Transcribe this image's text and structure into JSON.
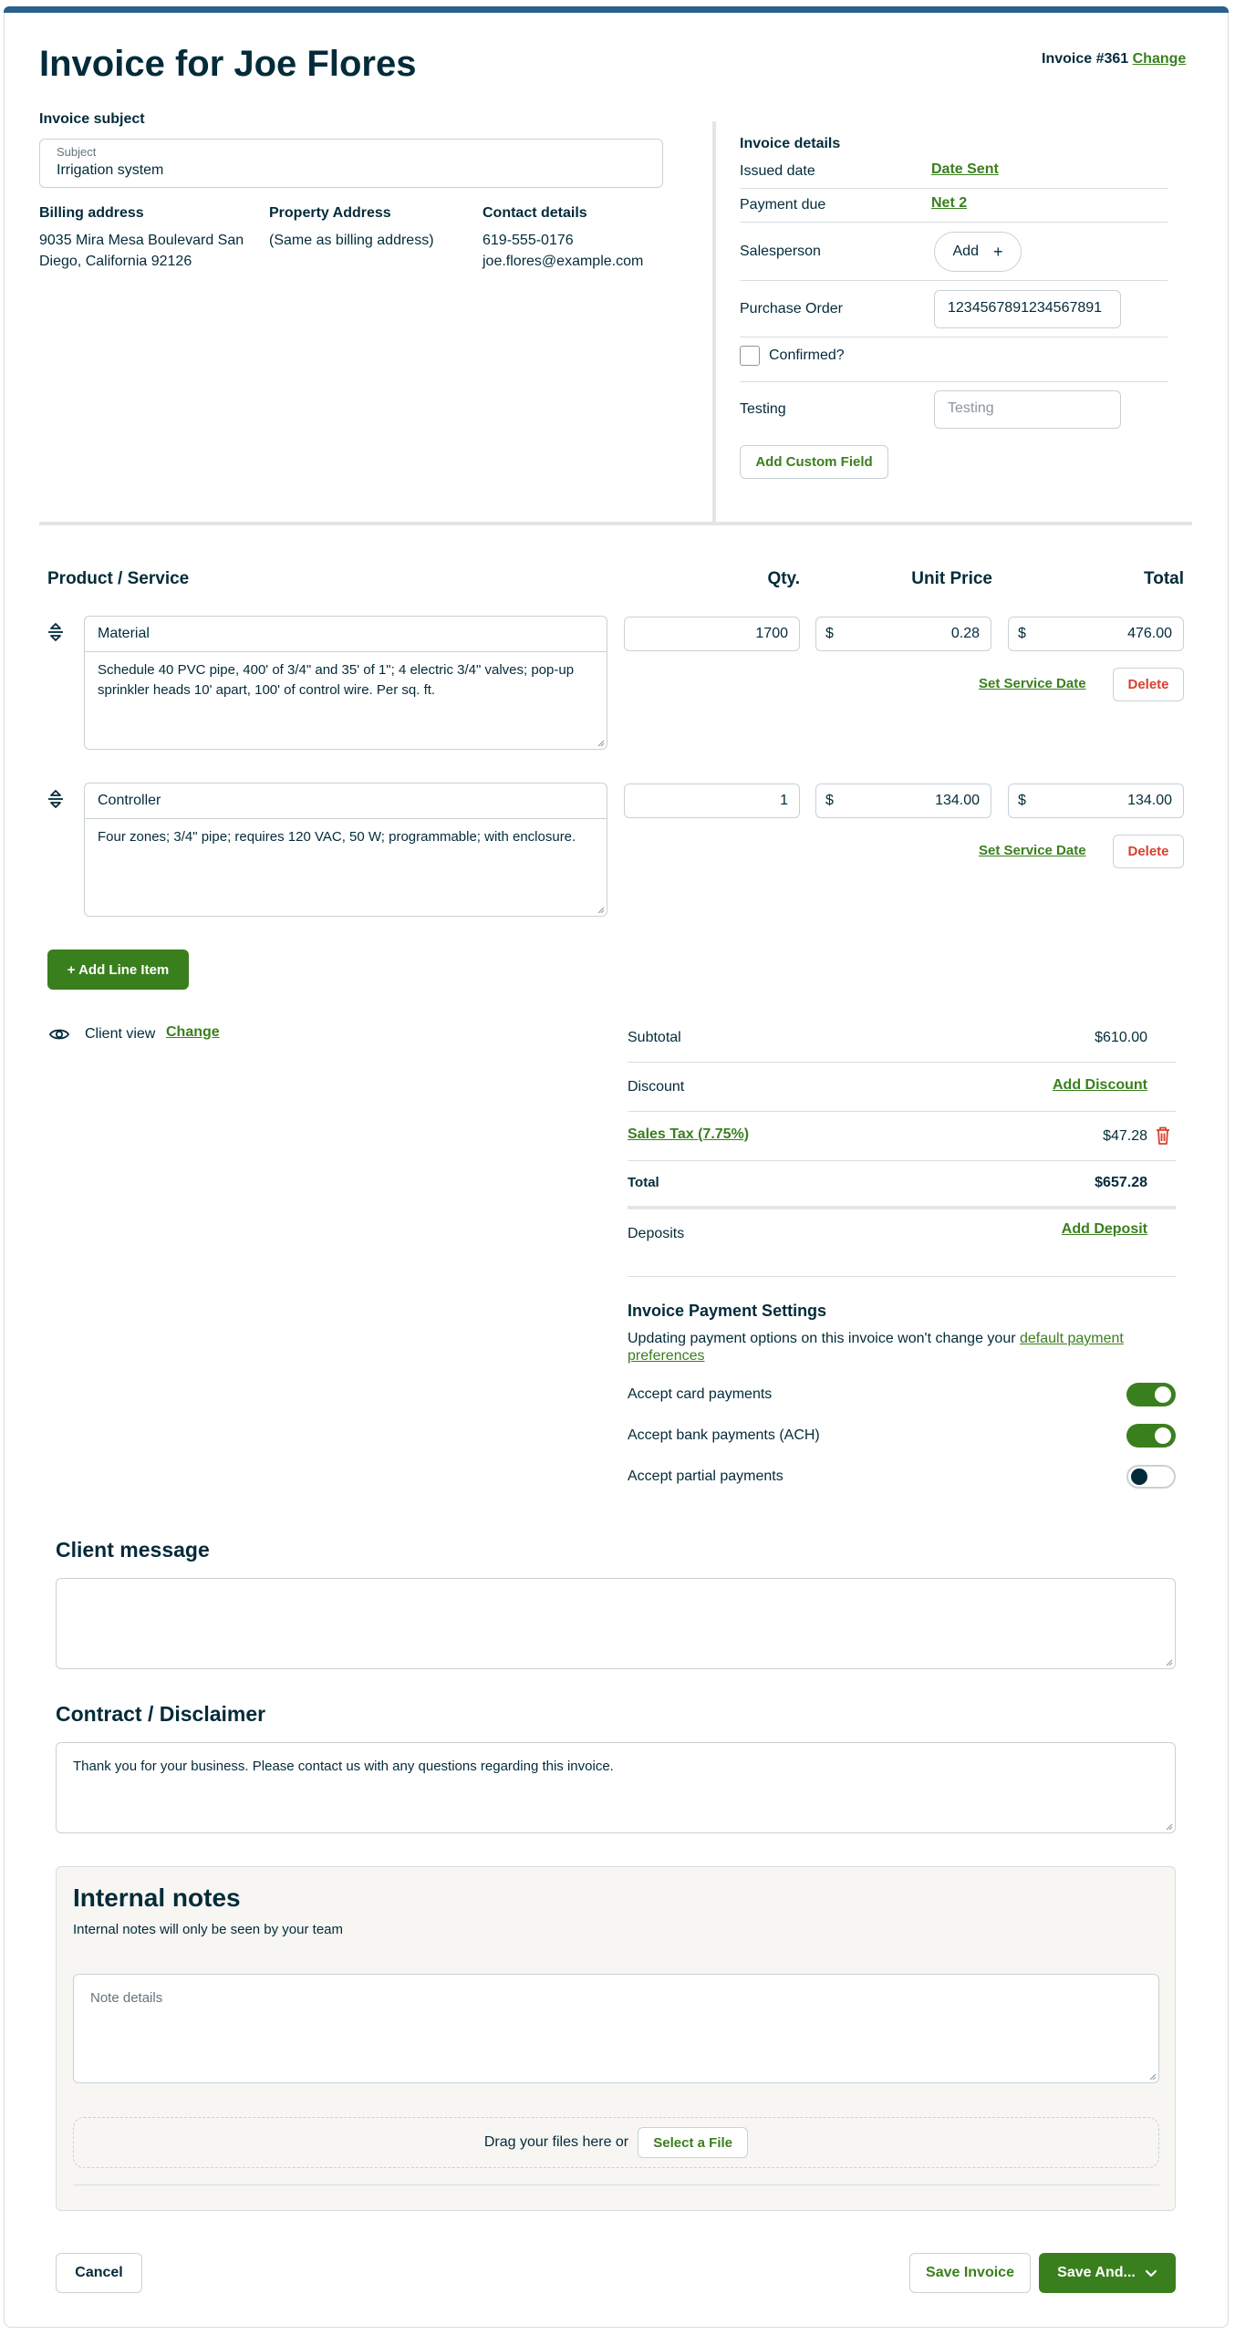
{
  "header": {
    "title": "Invoice for Joe Flores",
    "invoice_number": "Invoice #361",
    "change_label": "Change"
  },
  "subject": {
    "section_label": "Invoice subject",
    "field_label": "Subject",
    "value": "Irrigation system"
  },
  "billing": {
    "label": "Billing address",
    "line1": "9035 Mira Mesa Boulevard San",
    "line2": "Diego, California 92126"
  },
  "property": {
    "label": "Property Address",
    "value": "(Same as billing address)"
  },
  "contact": {
    "label": "Contact details",
    "phone": "619-555-0176",
    "email": "joe.flores@example.com"
  },
  "details": {
    "title": "Invoice details",
    "issued_label": "Issued date",
    "issued_value": "Date Sent",
    "due_label": "Payment due",
    "due_value": "Net 2",
    "salesperson_label": "Salesperson",
    "salesperson_button": "Add",
    "po_label": "Purchase Order",
    "po_value": "1234567891234567891",
    "confirmed_label": "Confirmed?",
    "testing_label": "Testing",
    "testing_placeholder": "Testing",
    "add_custom_field": "Add Custom Field"
  },
  "line_items_header": {
    "product": "Product / Service",
    "qty": "Qty.",
    "unit_price": "Unit Price",
    "total": "Total"
  },
  "line_items": [
    {
      "name": "Material",
      "description": "Schedule 40 PVC pipe, 400' of 3/4\" and 35' of 1\"; 4 electric 3/4\" valves; pop-up sprinkler heads 10' apart, 100' of control wire. Per sq. ft.",
      "qty": "1700",
      "currency": "$",
      "unit_price": "0.28",
      "total": "476.00",
      "set_date": "Set Service Date",
      "delete": "Delete"
    },
    {
      "name": "Controller",
      "description": "Four zones; 3/4\" pipe; requires 120 VAC, 50 W; programmable; with enclosure.",
      "qty": "1",
      "currency": "$",
      "unit_price": "134.00",
      "total": "134.00",
      "set_date": "Set Service Date",
      "delete": "Delete"
    }
  ],
  "add_line_item": "+ Add Line Item",
  "client_view": {
    "label": "Client view",
    "change": "Change"
  },
  "totals": {
    "subtotal_label": "Subtotal",
    "subtotal_value": "$610.00",
    "discount_label": "Discount",
    "discount_action": "Add Discount",
    "tax_label": "Sales Tax (7.75%)",
    "tax_value": "$47.28",
    "total_label": "Total",
    "total_value": "$657.28",
    "deposits_label": "Deposits",
    "deposits_action": "Add Deposit"
  },
  "payment_settings": {
    "title": "Invoice Payment Settings",
    "note": "Updating payment options on this invoice won't change your ",
    "note_link_1": "default payment",
    "note_link_2": "preferences",
    "options": [
      {
        "label": "Accept card payments",
        "enabled": true
      },
      {
        "label": "Accept bank payments (ACH)",
        "enabled": true
      },
      {
        "label": "Accept partial payments",
        "enabled": false
      }
    ]
  },
  "client_message": {
    "title": "Client message",
    "value": ""
  },
  "contract": {
    "title": "Contract / Disclaimer",
    "value": "Thank you for your business. Please contact us with any questions regarding this invoice."
  },
  "internal_notes": {
    "title": "Internal notes",
    "subtitle": "Internal notes will only be seen by your team",
    "placeholder": "Note details",
    "drop_text": "Drag your files here or",
    "select_file": "Select a File"
  },
  "footer": {
    "cancel": "Cancel",
    "save_invoice": "Save Invoice",
    "save_and": "Save And..."
  },
  "colors": {
    "brand_green": "#3a7f1d",
    "text_dark": "#032b3a",
    "danger": "#d8402f",
    "top_bar": "#2b5f8c"
  },
  "icons": {
    "sort": "sort-handle-icon",
    "eye": "eye-icon",
    "trash": "trash-icon",
    "chevron": "chevron-down-icon",
    "plus": "plus-icon"
  }
}
